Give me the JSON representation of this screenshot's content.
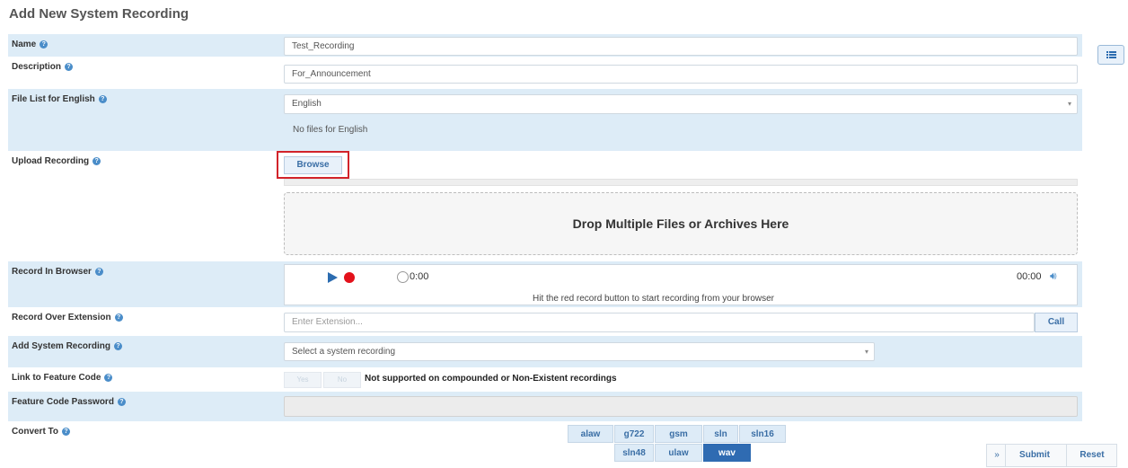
{
  "page": {
    "title": "Add New System Recording"
  },
  "help_glyph": "?",
  "fields": {
    "name": {
      "label": "Name",
      "value": "Test_Recording"
    },
    "description": {
      "label": "Description",
      "value": "For_Announcement"
    },
    "file_list": {
      "label": "File List for English",
      "selected": "English",
      "info": "No files for English"
    },
    "upload": {
      "label": "Upload Recording",
      "browse_label": "Browse",
      "dropzone_text": "Drop Multiple Files or Archives Here"
    },
    "record_in_browser": {
      "label": "Record In Browser",
      "elapsed": "0:00",
      "duration": "00:00",
      "hint": "Hit the red record button to start recording from your browser"
    },
    "record_over_extension": {
      "label": "Record Over Extension",
      "placeholder": "Enter Extension...",
      "call_label": "Call"
    },
    "add_system_recording": {
      "label": "Add System Recording",
      "placeholder": "Select a system recording"
    },
    "link_feature_code": {
      "label": "Link to Feature Code",
      "yes_label": "Yes",
      "no_label": "No",
      "note": "Not supported on compounded or Non-Existent recordings"
    },
    "feature_code_password": {
      "label": "Feature Code Password"
    },
    "convert_to": {
      "label": "Convert To",
      "formats_row1": [
        "alaw",
        "g722",
        "gsm",
        "sln",
        "sln16"
      ],
      "formats_row2": [
        "sln48",
        "ulaw",
        "wav"
      ],
      "active": "wav"
    }
  },
  "actions": {
    "expand_glyph": "»",
    "submit_label": "Submit",
    "reset_label": "Reset"
  },
  "colors": {
    "row_blue": "#ddecf7",
    "accent": "#2f6bb2",
    "record_red": "#e3111b",
    "highlight_red": "#d2232a"
  }
}
